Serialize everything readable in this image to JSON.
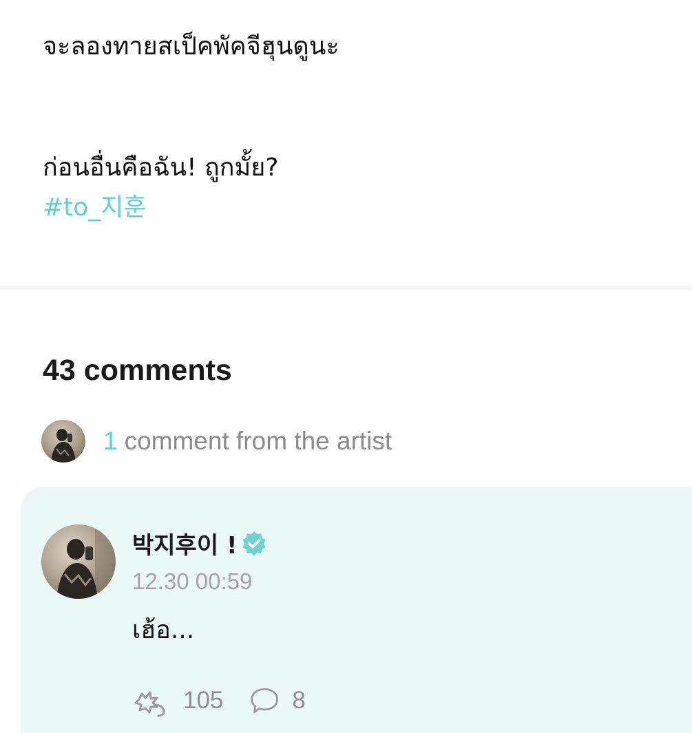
{
  "post": {
    "line1": "จะลองทายสเป็คพัคจีฮุนดูนะ",
    "line2": "ก่อนอื่นคือฉัน! ถูกมั้ย?",
    "hashtag": "#to_지훈"
  },
  "comments": {
    "count_label": "43 comments",
    "artist_count": "1",
    "artist_label": "comment from the artist"
  },
  "artist_comment": {
    "author": "박지후이 !",
    "timestamp": "12.30 00:59",
    "text": "เฮ้อ...",
    "like_count": "105",
    "reply_count": "8"
  },
  "colors": {
    "accent": "#5cd1cf",
    "card_bg": "#eaf8f6",
    "muted": "#8e8e8e"
  },
  "icons": {
    "verified": "verified-badge-icon",
    "like": "sparkle-like-icon",
    "reply": "speech-bubble-icon"
  }
}
